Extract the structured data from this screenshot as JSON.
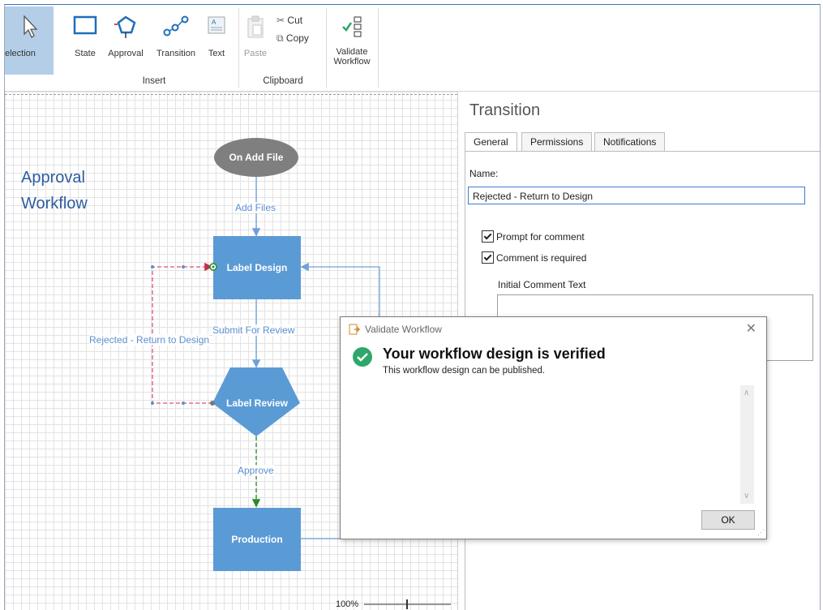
{
  "ribbon": {
    "selection_label": "election",
    "insert": {
      "state_label": "State",
      "approval_label": "Approval",
      "transition_label": "Transition",
      "text_label": "Text",
      "group_label": "Insert"
    },
    "clipboard": {
      "paste_label": "Paste",
      "cut_label": "Cut",
      "copy_label": "Copy",
      "group_label": "Clipboard"
    },
    "validate_label_1": "Validate",
    "validate_label_2": "Workflow"
  },
  "canvas": {
    "title_line1": "Approval",
    "title_line2": "Workflow",
    "nodes": {
      "start": "On Add File",
      "label_design": "Label Design",
      "label_review": "Label Review",
      "production": "Production"
    },
    "edges": {
      "add_files": "Add Files",
      "submit_for_review": "Submit For Review",
      "rejected": "Rejected - Return to Design",
      "approve": "Approve"
    },
    "zoom": "100%"
  },
  "panel": {
    "title": "Transition",
    "tabs": [
      "General",
      "Permissions",
      "Notifications"
    ],
    "name_label": "Name:",
    "name_value": "Rejected - Return to Design",
    "prompt_for_comment": "Prompt for comment",
    "comment_required": "Comment is required",
    "initial_comment_label": "Initial Comment Text"
  },
  "dialog": {
    "title": "Validate Workflow",
    "heading": "Your workflow design is verified",
    "subtext": "This workflow design can be published.",
    "ok_label": "OK"
  },
  "colors": {
    "node_fill": "#5b9bd5",
    "start_fill": "#7f7f7f",
    "edge_blue": "#6fa0d8",
    "edge_red": "#e0506a",
    "edge_green": "#3a9a3a",
    "success_green": "#2fa76a"
  }
}
